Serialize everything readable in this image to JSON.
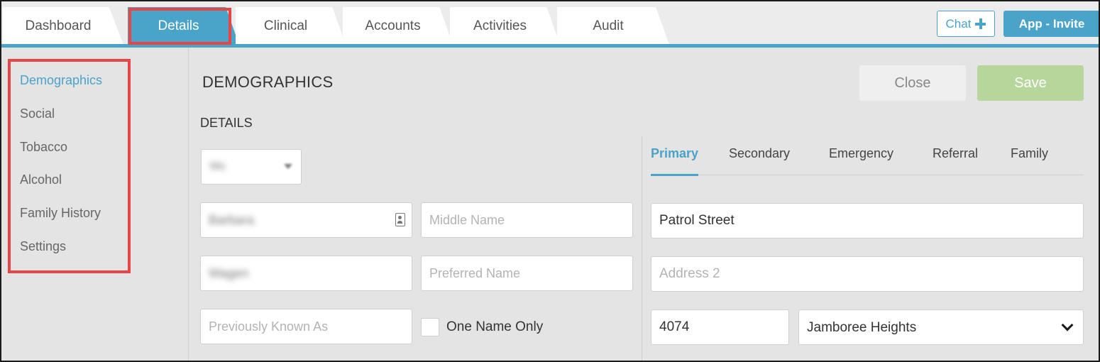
{
  "tabs": [
    {
      "label": "Dashboard",
      "active": false
    },
    {
      "label": "Details",
      "active": true
    },
    {
      "label": "Clinical",
      "active": false
    },
    {
      "label": "Accounts",
      "active": false
    },
    {
      "label": "Activities",
      "active": false
    },
    {
      "label": "Audit",
      "active": false
    }
  ],
  "header": {
    "chat_label": "Chat",
    "invite_label": "App - Invite"
  },
  "sidebar": {
    "items": [
      {
        "label": "Demographics",
        "active": true
      },
      {
        "label": "Social",
        "active": false
      },
      {
        "label": "Tobacco",
        "active": false
      },
      {
        "label": "Alcohol",
        "active": false
      },
      {
        "label": "Family History",
        "active": false
      },
      {
        "label": "Settings",
        "active": false
      }
    ]
  },
  "main": {
    "page_title": "DEMOGRAPHICS",
    "section_title": "DETAILS",
    "close_label": "Close",
    "save_label": "Save"
  },
  "details": {
    "title_value": "Ms",
    "first_name_value": "Barbara",
    "middle_name_placeholder": "Middle Name",
    "last_name_value": "Wagen",
    "preferred_name_placeholder": "Preferred Name",
    "previously_known_placeholder": "Previously Known As",
    "one_name_only_label": "One Name Only"
  },
  "address": {
    "tabs": [
      {
        "label": "Primary",
        "active": true
      },
      {
        "label": "Secondary",
        "active": false
      },
      {
        "label": "Emergency",
        "active": false
      },
      {
        "label": "Referral",
        "active": false
      },
      {
        "label": "Family",
        "active": false
      }
    ],
    "street_value": "Patrol Street",
    "address2_placeholder": "Address 2",
    "postcode_value": "4074",
    "suburb_value": "Jamboree Heights"
  },
  "colors": {
    "accent": "#4aa3c8",
    "highlight": "#e84545",
    "save": "#b7d69c"
  }
}
